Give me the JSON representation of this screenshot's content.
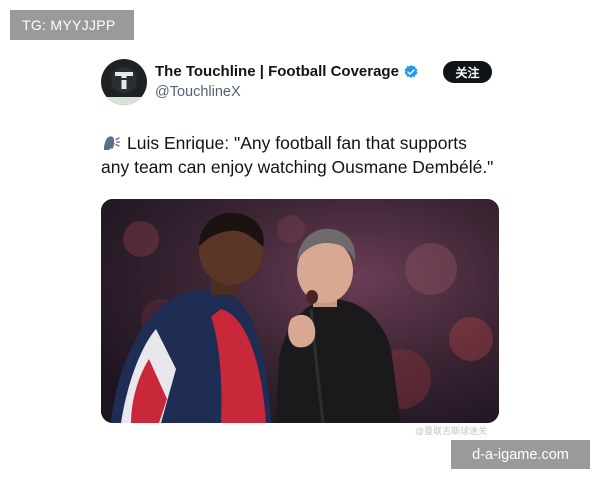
{
  "overlay": {
    "tg_label": "TG: MYYJJPP",
    "site_label": "d-a-igame.com",
    "photo_watermark": "@曼联吉斯球迷关"
  },
  "tweet": {
    "display_name": "The Touchline | Football Coverage",
    "handle": "@TouchlineX",
    "follow_label": "关注",
    "text_line1": "Luis Enrique: \"Any football fan that supports",
    "text_line2": "any team can enjoy watching Ousmane Dembélé.\"",
    "verified_color": "#1d9bf0",
    "avatar_letter": "T"
  }
}
